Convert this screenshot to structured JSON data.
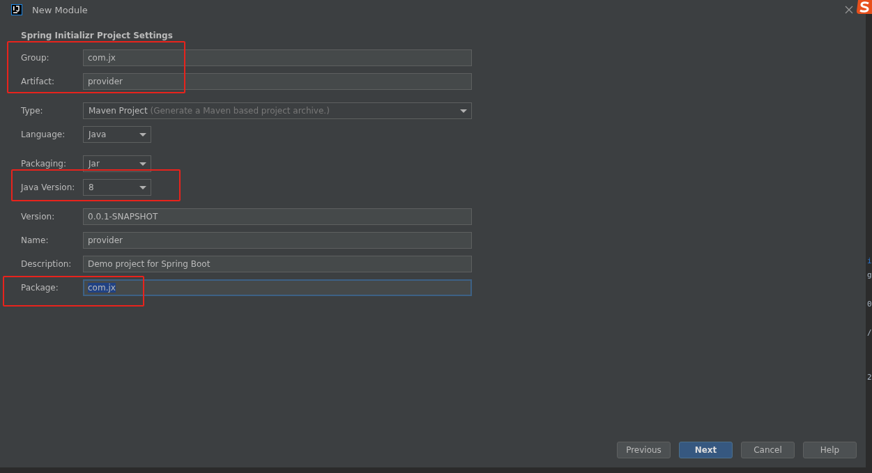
{
  "window": {
    "title": "New Module"
  },
  "section_title": "Spring Initializr Project Settings",
  "fields": [
    {
      "kind": "text",
      "label": "Group:",
      "value": "com.jx",
      "focused": false
    },
    {
      "kind": "text",
      "label": "Artifact:",
      "value": "provider",
      "focused": false
    },
    {
      "kind": "select",
      "label": "Type:",
      "value": "Maven Project",
      "hint": "(Generate a Maven based project archive.)",
      "wide": true
    },
    {
      "kind": "select",
      "label": "Language:",
      "value": "Java",
      "wide": false
    },
    {
      "kind": "select",
      "label": "Packaging:",
      "value": "Jar",
      "wide": false
    },
    {
      "kind": "select",
      "label": "Java Version:",
      "value": "8",
      "wide": false
    },
    {
      "kind": "text",
      "label": "Version:",
      "value": "0.0.1-SNAPSHOT",
      "focused": false
    },
    {
      "kind": "text",
      "label": "Name:",
      "value": "provider",
      "focused": false
    },
    {
      "kind": "text",
      "label": "Description:",
      "value": "Demo project for Spring Boot",
      "focused": false
    },
    {
      "kind": "text",
      "label": "Package:",
      "value": "com.jx",
      "focused": true
    }
  ],
  "buttons": [
    {
      "label": "Previous",
      "default": false
    },
    {
      "label": "Next",
      "default": true
    },
    {
      "label": "Cancel",
      "default": false
    },
    {
      "label": "Help",
      "default": false
    }
  ],
  "background_editor": [
    "i",
    "g",
    "0",
    "/",
    "2"
  ]
}
